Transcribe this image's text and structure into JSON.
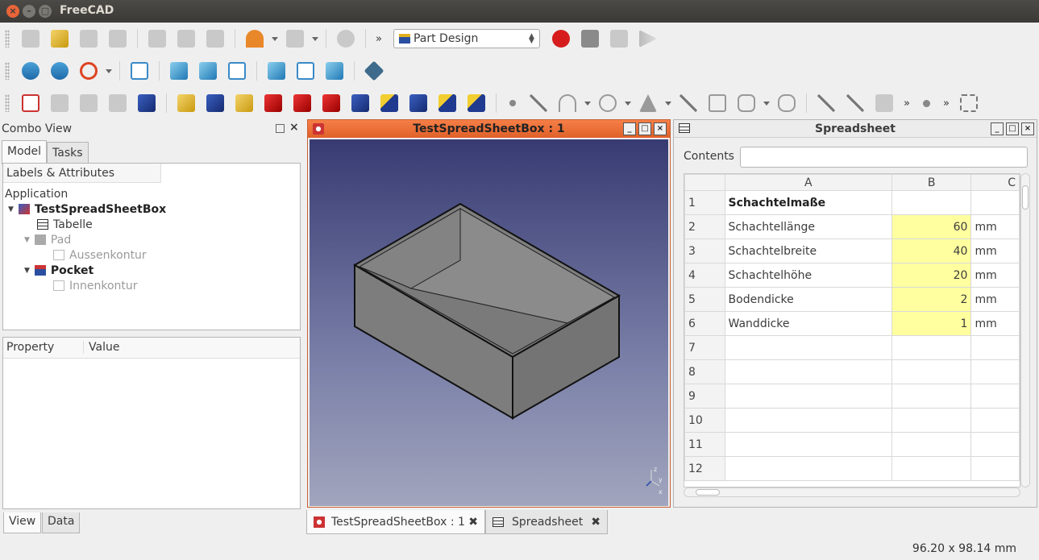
{
  "window": {
    "title": "FreeCAD"
  },
  "toolbar": {
    "workbench": "Part Design",
    "more": "»"
  },
  "combo": {
    "title": "Combo View",
    "tabs": [
      {
        "label": "Model"
      },
      {
        "label": "Tasks"
      }
    ],
    "tree_header": "Labels & Attributes",
    "tree": [
      {
        "label": "Application",
        "level": 0,
        "style": "normal"
      },
      {
        "label": "TestSpreadSheetBox",
        "level": 1,
        "style": "bold"
      },
      {
        "label": "Tabelle",
        "level": 2,
        "style": "normal"
      },
      {
        "label": "Pad",
        "level": 2,
        "style": "grey"
      },
      {
        "label": "Aussenkontur",
        "level": 3,
        "style": "grey"
      },
      {
        "label": "Pocket",
        "level": 2,
        "style": "bold"
      },
      {
        "label": "Innenkontur",
        "level": 3,
        "style": "grey"
      }
    ],
    "props_headers": [
      "Property",
      "Value"
    ],
    "bottom_tabs": [
      {
        "label": "View"
      },
      {
        "label": "Data"
      }
    ]
  },
  "view3d": {
    "title": "TestSpreadSheetBox : 1"
  },
  "spreadsheet": {
    "title": "Spreadsheet",
    "contents_label": "Contents",
    "columns": [
      "A",
      "B",
      "C"
    ],
    "rows": [
      {
        "n": "1",
        "a": "Schachtelmaße",
        "b": "",
        "c": ""
      },
      {
        "n": "2",
        "a": "Schachtellänge",
        "b": "60",
        "c": "mm"
      },
      {
        "n": "3",
        "a": "Schachtelbreite",
        "b": "40",
        "c": "mm"
      },
      {
        "n": "4",
        "a": "Schachtelhöhe",
        "b": "20",
        "c": "mm"
      },
      {
        "n": "5",
        "a": "Bodendicke",
        "b": "2",
        "c": "mm"
      },
      {
        "n": "6",
        "a": "Wanddicke",
        "b": "1",
        "c": "mm"
      },
      {
        "n": "7",
        "a": "",
        "b": "",
        "c": ""
      },
      {
        "n": "8",
        "a": "",
        "b": "",
        "c": ""
      },
      {
        "n": "9",
        "a": "",
        "b": "",
        "c": ""
      },
      {
        "n": "10",
        "a": "",
        "b": "",
        "c": ""
      },
      {
        "n": "11",
        "a": "",
        "b": "",
        "c": ""
      },
      {
        "n": "12",
        "a": "",
        "b": "",
        "c": ""
      }
    ]
  },
  "doc_tabs": [
    {
      "label": "TestSpreadSheetBox : 1"
    },
    {
      "label": "Spreadsheet"
    }
  ],
  "status": {
    "dimensions": "96.20 x 98.14 mm"
  },
  "colors": {
    "accent": "#e8643a",
    "cell_highlight": "#ffff9f",
    "viewport_top": "#373b72",
    "viewport_bottom": "#a1a5bd"
  }
}
